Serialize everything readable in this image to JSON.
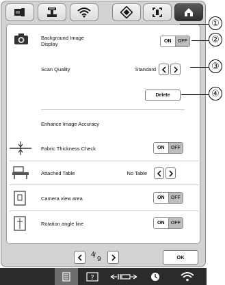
{
  "tabs": [
    {
      "icon": "sewing-settings-icon"
    },
    {
      "icon": "embroidery-settings-icon"
    },
    {
      "icon": "wifi-settings-icon"
    },
    {
      "icon": "general-settings-icon"
    },
    {
      "icon": "camera-settings-icon"
    },
    {
      "icon": "home-settings-icon",
      "active": true
    }
  ],
  "settings": {
    "background_image_display": {
      "label_line1": "Background Image",
      "label_line2": "Display",
      "on": "ON",
      "off": "OFF"
    },
    "scan_quality": {
      "label": "Scan Quality",
      "value": "Standard"
    },
    "delete_button": "Delete",
    "enhance_image_accuracy": {
      "label": "Enhance Image Accuracy"
    },
    "fabric_thickness_check": {
      "label": "Fabric Thickness Check",
      "on": "ON",
      "off": "OFF"
    },
    "attached_table": {
      "label": "Attached Table",
      "value": "No Table"
    },
    "camera_view_area": {
      "label": "Camera view area",
      "on": "ON",
      "off": "OFF"
    },
    "rotation_angle_line": {
      "label": "Rotation angle line",
      "on": "ON",
      "off": "OFF"
    }
  },
  "pager": {
    "current": "4",
    "total": "9"
  },
  "ok_button": "OK",
  "callouts": [
    "①",
    "②",
    "③",
    "④"
  ],
  "statusbar": [
    {
      "icon": "manual-icon",
      "active": true
    },
    {
      "icon": "help-icon"
    },
    {
      "icon": "presser-foot-icon"
    },
    {
      "icon": "clock-icon"
    },
    {
      "icon": "wifi-icon"
    }
  ],
  "colors": {
    "panel_bg": "#d3d3d3",
    "content_bg": "#ffffff",
    "off_bg": "#bdbdbd",
    "active_tab": "#3a3a3a",
    "statusbar": "#2b2b2b"
  }
}
